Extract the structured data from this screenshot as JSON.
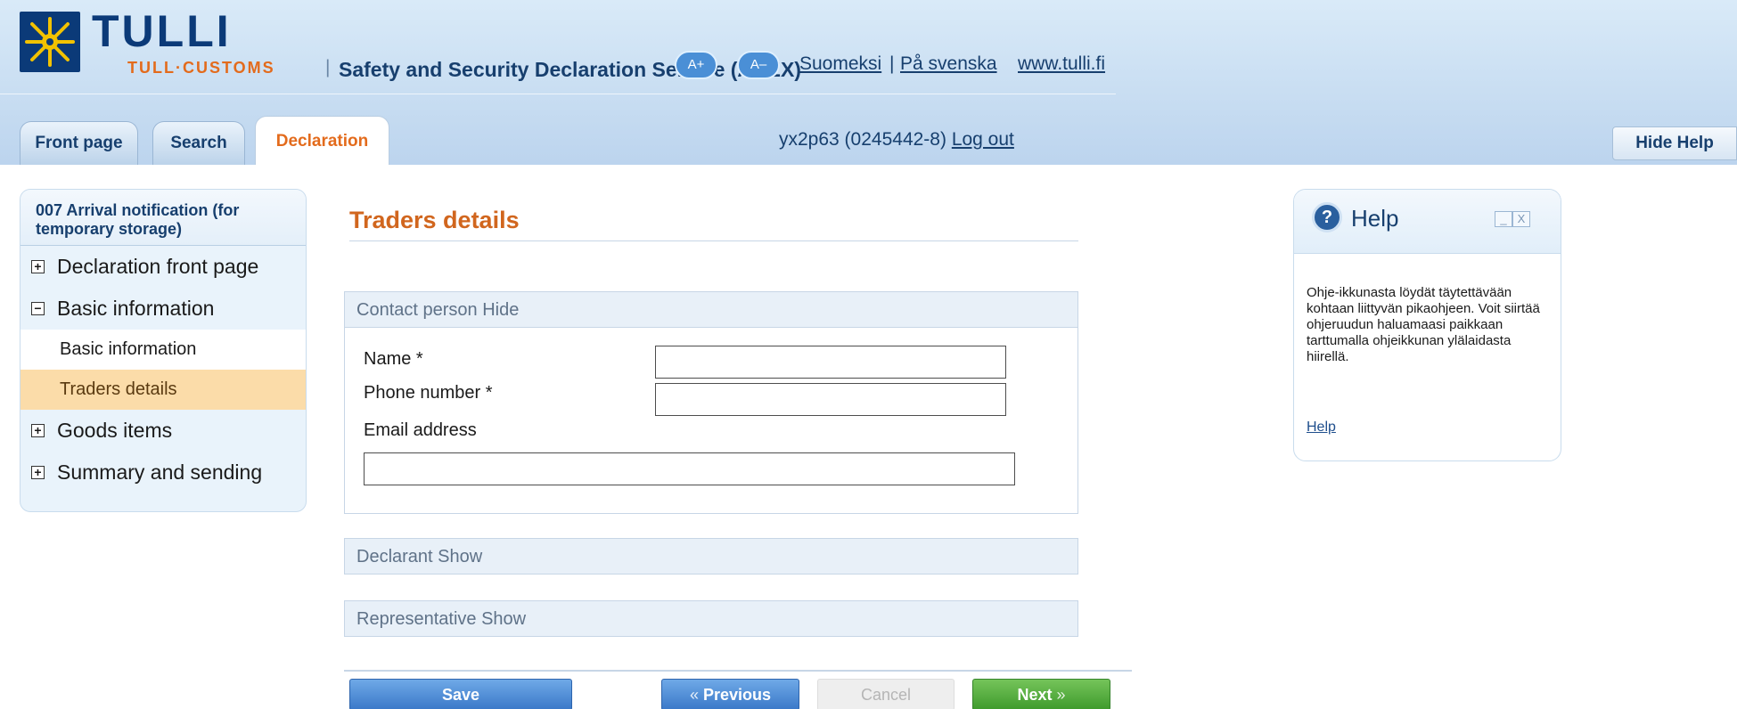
{
  "header": {
    "brand": "TULLI",
    "brand_sub": "TULL·CUSTOMS",
    "separator": "|",
    "service_title": "Safety and Security Declaration Service (AREX)",
    "font_increase": "A+",
    "font_decrease": "A–",
    "languages": {
      "fi": "Suomeksi",
      "sv": "På svenska",
      "pipe": "|"
    },
    "site_link": "www.tulli.fi",
    "user": "yx2p63 (0245442-8)",
    "logout": "Log out",
    "hide_help": "Hide Help"
  },
  "tabs": [
    {
      "label": "Front page"
    },
    {
      "label": "Search"
    },
    {
      "label": "Declaration",
      "active": true
    }
  ],
  "nav": {
    "title": "007 Arrival notification (for temporary storage)",
    "groups": [
      {
        "label": "Declaration front page",
        "toggle": "+"
      },
      {
        "label": "Basic information",
        "toggle": "−"
      },
      {
        "label": "Goods items",
        "toggle": "+"
      },
      {
        "label": "Summary and sending",
        "toggle": "+"
      }
    ],
    "sub_items": [
      {
        "label": "Basic information"
      },
      {
        "label": "Traders details",
        "active": true
      }
    ]
  },
  "main": {
    "title": "Traders details",
    "sections": {
      "contact": "Contact person Hide",
      "declarant": "Declarant Show",
      "representative": "Representative Show"
    },
    "fields": {
      "name_label": "Name *",
      "name_value": "",
      "phone_label": "Phone number *",
      "phone_value": "",
      "email_label": "Email address",
      "email_value": ""
    },
    "buttons": {
      "save": "Save",
      "previous": "Previous",
      "cancel": "Cancel",
      "next": "Next",
      "prev_chevron": "«",
      "next_chevron": "»"
    }
  },
  "help": {
    "title": "Help",
    "icon": "?",
    "minimize": "_",
    "close": "X",
    "text": "Ohje-ikkunasta löydät täytettävään kohtaan liittyvän pikaohjeen. Voit siirtää ohjeruudun haluamaasi paikkaan tarttumalla ohjeikkunan ylälaidasta hiirellä.",
    "link": "Help"
  },
  "colors": {
    "brand_navy": "#0b3a78",
    "accent_orange": "#e36b1c",
    "header_blue": "#c9def2",
    "active_nav": "#fbdca9",
    "button_blue": "#3a78c8",
    "button_green": "#3e9a2c"
  }
}
